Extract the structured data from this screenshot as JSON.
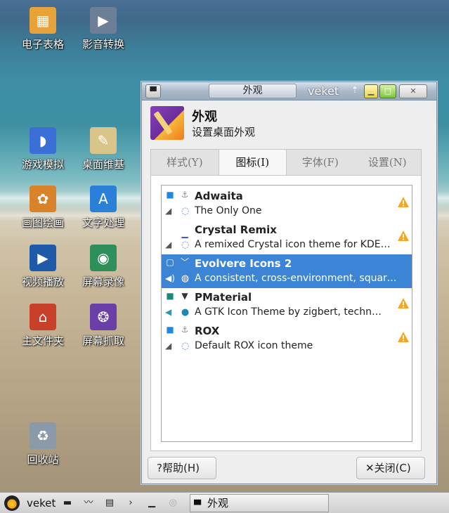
{
  "desktop": {
    "icons": [
      {
        "label": "电子表格",
        "icon": "spreadsheet-icon",
        "color": "#e8a23a"
      },
      {
        "label": "影音转换",
        "icon": "video-convert-icon",
        "color": "#6d7f97"
      },
      {
        "label": "游戏模拟",
        "icon": "dolphin-emulator-icon",
        "color": "#3a6fd8"
      },
      {
        "label": "桌面维基",
        "icon": "notepad-icon",
        "color": "#d9c48a"
      },
      {
        "label": "画图绘画",
        "icon": "paint-icon",
        "color": "#d8822a"
      },
      {
        "label": "文字处理",
        "icon": "word-processor-icon",
        "color": "#2a7fd8"
      },
      {
        "label": "视频播放",
        "icon": "video-player-icon",
        "color": "#1e5aa8"
      },
      {
        "label": "屏幕录像",
        "icon": "screen-recorder-icon",
        "color": "#2f8f5a"
      },
      {
        "label": "主文件夹",
        "icon": "home-folder-icon",
        "color": "#c9402a"
      },
      {
        "label": "屏幕抓取",
        "icon": "screenshot-icon",
        "color": "#6a3fa8"
      },
      {
        "label": "回收站",
        "icon": "trash-icon",
        "color": "#8a9aa8"
      }
    ]
  },
  "window": {
    "menu_glyph": "▀",
    "title": "外观",
    "app_name": "veket",
    "pin_glyph": "⇡",
    "min_glyph": "▁",
    "max_glyph": "□",
    "close_glyph": "✕",
    "header_title": "外观",
    "header_subtitle": "设置桌面外观",
    "tabs": [
      "样式(Y)",
      "图标(I)",
      "字体(F)",
      "设置(N)"
    ],
    "active_tab": 1,
    "themes": [
      {
        "name": "Adwaita",
        "description": "The Only One",
        "selected": false,
        "warning": true
      },
      {
        "name": "Crystal Remix",
        "description": "A remixed Crystal icon theme for KDE…",
        "selected": false,
        "warning": true
      },
      {
        "name": "Evolvere Icons 2",
        "description": "A consistent, cross-environment, square…",
        "selected": true,
        "warning": false
      },
      {
        "name": "PMaterial",
        "description": "A GTK Icon Theme by zigbert, techn…",
        "selected": false,
        "warning": true
      },
      {
        "name": "ROX",
        "description": "Default ROX icon theme",
        "selected": false,
        "warning": true
      }
    ],
    "help_button": "帮助(H)",
    "close_button": "关闭(C)",
    "colors": {
      "selection": "#3b84d6",
      "warning": "#f5a623"
    }
  },
  "taskbar": {
    "app_label": "veket",
    "task_title": "外观"
  }
}
